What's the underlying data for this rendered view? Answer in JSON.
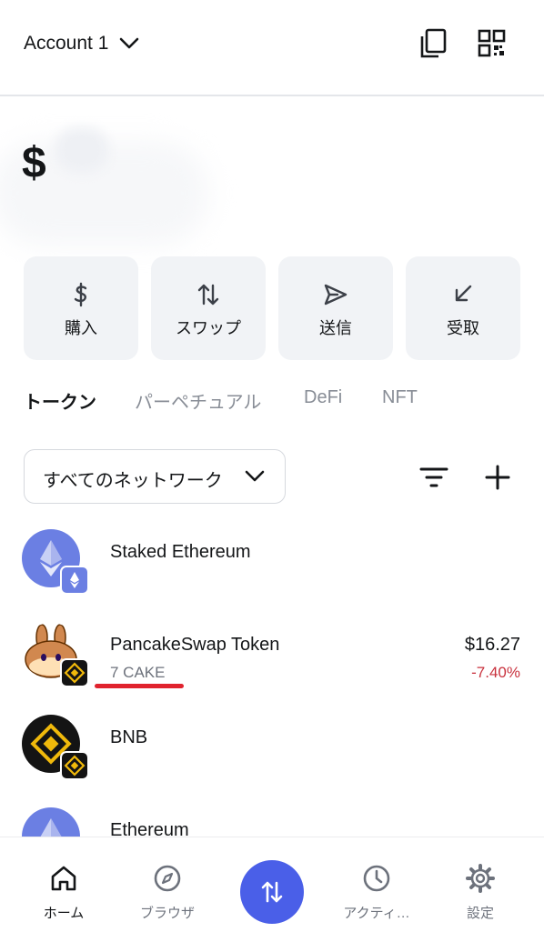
{
  "header": {
    "account_label": "Account 1"
  },
  "balance": {
    "currency_symbol": "$"
  },
  "actions": [
    {
      "label": "購入",
      "icon": "dollar-icon"
    },
    {
      "label": "スワップ",
      "icon": "swap-arrows-icon"
    },
    {
      "label": "送信",
      "icon": "send-icon"
    },
    {
      "label": "受取",
      "icon": "receive-icon"
    }
  ],
  "tabs": [
    {
      "label": "トークン",
      "active": true
    },
    {
      "label": "パーペチュアル",
      "active": false
    },
    {
      "label": "DeFi",
      "active": false
    },
    {
      "label": "NFT",
      "active": false
    }
  ],
  "network_selector": {
    "label": "すべてのネットワーク"
  },
  "tokens": [
    {
      "name": "Staked Ethereum",
      "subtitle": "",
      "value": "",
      "change": ""
    },
    {
      "name": "PancakeSwap Token",
      "subtitle": "7 CAKE",
      "value": "$16.27",
      "change": "-7.40%"
    },
    {
      "name": "BNB",
      "subtitle": "",
      "value": "",
      "change": ""
    },
    {
      "name": "Ethereum",
      "subtitle": "",
      "value": "",
      "change": ""
    }
  ],
  "colors": {
    "accent": "#4a5fe8",
    "negative": "#c9323e",
    "highlight_underline": "#e0232e"
  },
  "bottom_nav": [
    {
      "label": "ホーム",
      "icon": "home-icon",
      "active": true
    },
    {
      "label": "ブラウザ",
      "icon": "compass-icon",
      "active": false
    },
    {
      "label": "アクティ…",
      "icon": "clock-icon",
      "active": false
    },
    {
      "label": "設定",
      "icon": "gear-icon",
      "active": false
    }
  ]
}
